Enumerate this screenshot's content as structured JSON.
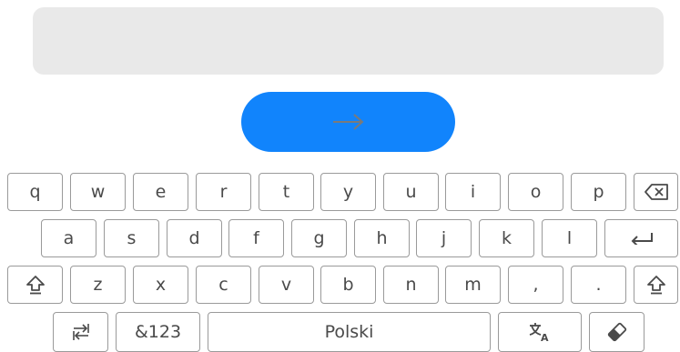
{
  "colors": {
    "input_bg": "#e9e9e9",
    "submit_bg": "#1184fc",
    "submit_arrow": "#7a7a7a",
    "key_border": "#9a9a9a",
    "key_text": "#4a4a4a"
  },
  "submit": {
    "icon": "arrow-right-icon"
  },
  "keyboard": {
    "row1": [
      "q",
      "w",
      "e",
      "r",
      "t",
      "y",
      "u",
      "i",
      "o",
      "p"
    ],
    "row2": [
      "a",
      "s",
      "d",
      "f",
      "g",
      "h",
      "j",
      "k",
      "l"
    ],
    "row3": [
      "z",
      "x",
      "c",
      "v",
      "b",
      "n",
      "m",
      ",",
      "."
    ],
    "row4": {
      "symbols_label": "&123",
      "space_label": "Polski"
    },
    "icons": {
      "backspace": "backspace-icon",
      "enter": "enter-icon",
      "shift": "shift-icon",
      "tab": "tab-icon",
      "language": "language-icon",
      "clear": "eraser-icon"
    }
  }
}
